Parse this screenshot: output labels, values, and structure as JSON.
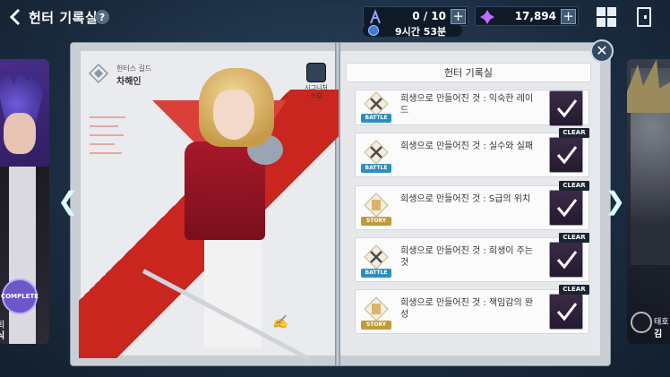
{
  "header": {
    "back_icon": "chevron-left-icon",
    "title": "헌터 기록실",
    "help_label": "?"
  },
  "resources": {
    "energy": {
      "value": "0 / 10",
      "icon": "energy-figure-icon",
      "plus": "+"
    },
    "gems": {
      "value": "17,894",
      "icon": "purple-crystal-icon",
      "plus": "+"
    },
    "timer": "9시간 53분"
  },
  "left_card": {
    "label": "COMPLETE",
    "subtitle": "회",
    "name": "식"
  },
  "right_card": {
    "subtitle": "태호",
    "name": "김"
  },
  "hunter": {
    "guild_label": "헌터스 길드",
    "name": "차해인",
    "ability_label": "시그니처 스킬"
  },
  "panel": {
    "title": "헌터 기록실",
    "close": "✕"
  },
  "quests": [
    {
      "type": "BATTLE",
      "text": "희생으로 만들어진 것 : 익숙한 레이드",
      "clear": ""
    },
    {
      "type": "BATTLE",
      "text": "희생으로 만들어진 것 : 실수와 실패",
      "clear": "CLEAR"
    },
    {
      "type": "STORY",
      "text": "희생으로 만들어진 것 : S급의 위치",
      "clear": "CLEAR"
    },
    {
      "type": "BATTLE",
      "text": "희생으로 만들어진 것 : 희생이 주는 것",
      "clear": "CLEAR"
    },
    {
      "type": "STORY",
      "text": "희생으로 만들어진 것 : 책임감의 완성",
      "clear": "CLEAR"
    }
  ],
  "colors": {
    "battle_tag": "#2d8fbf",
    "story_tag": "#c19a3a",
    "accent_red": "#c9261f",
    "check": "#ffffff"
  }
}
